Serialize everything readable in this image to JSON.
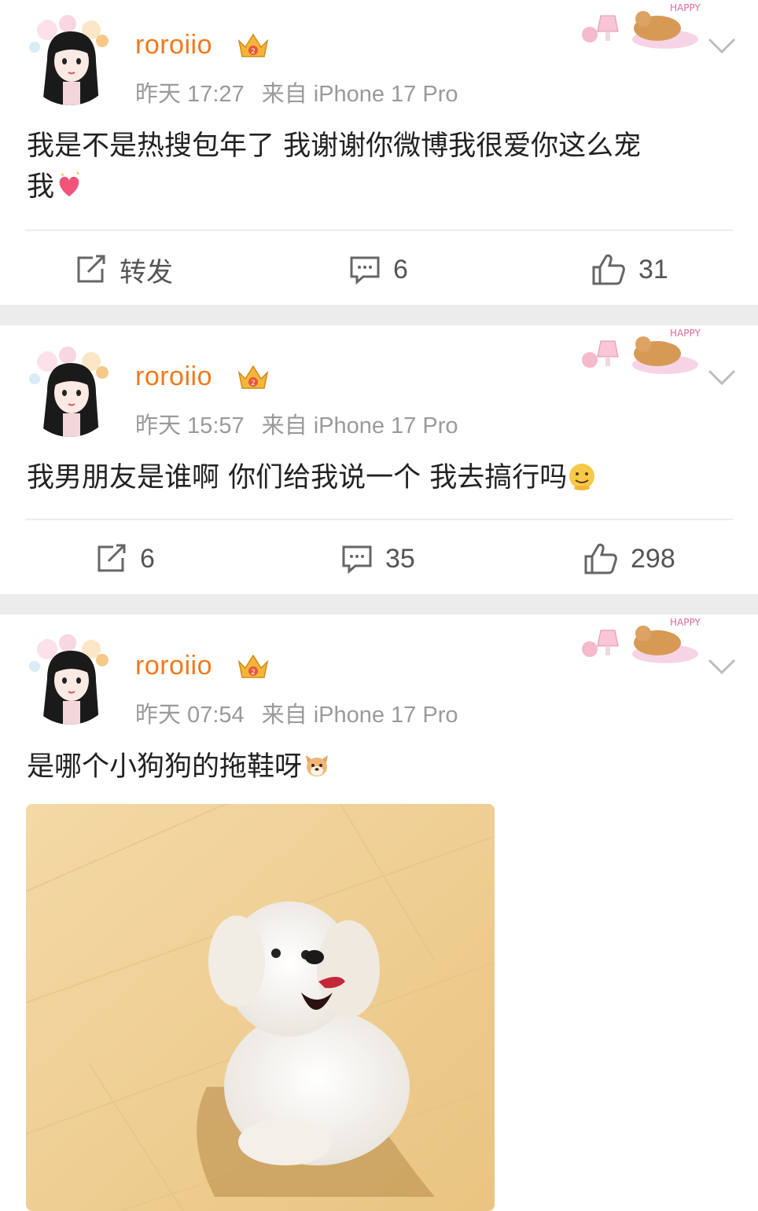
{
  "posts": [
    {
      "username": "roroiio",
      "time": "昨天 17:27",
      "source": "来自 iPhone 17 Pro",
      "text_line1": "我是不是热搜包年了 我谢谢你微博我很爱你这么宠",
      "text_line2": "我",
      "emoji": "heart-emoji",
      "actions": {
        "repost": "转发",
        "comments": "6",
        "likes": "31"
      }
    },
    {
      "username": "roroiio",
      "time": "昨天 15:57",
      "source": "来自 iPhone 17 Pro",
      "text_line1": "我男朋友是谁啊 你们给我说一个 我去搞行吗",
      "emoji": "smile-emoji",
      "actions": {
        "repost": "6",
        "comments": "35",
        "likes": "298"
      }
    },
    {
      "username": "roroiio",
      "time": "昨天 07:54",
      "source": "来自 iPhone 17 Pro",
      "text_line1": "是哪个小狗狗的拖鞋呀",
      "emoji": "dog-emoji",
      "image": "white-dog-photo"
    }
  ],
  "decoration_text": "HAPPY",
  "colors": {
    "username": "#f2791a",
    "meta": "#9a9a9a",
    "text": "#222222",
    "separator": "#ececec"
  },
  "icons": [
    "repost-icon",
    "comment-icon",
    "like-icon",
    "chevron-down-icon",
    "vip-crown-icon"
  ]
}
